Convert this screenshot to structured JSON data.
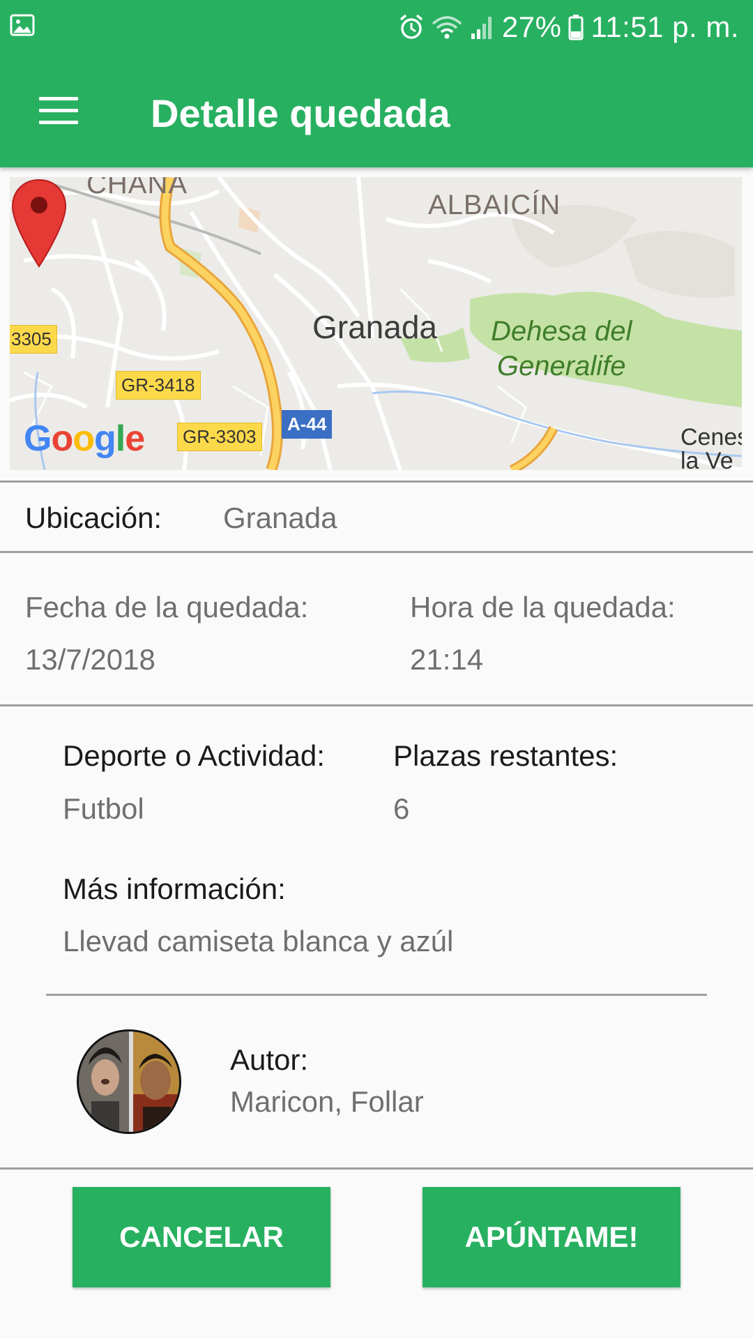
{
  "status_bar": {
    "battery": "27%",
    "time": "11:51 p. m.",
    "icons": [
      "gallery-icon",
      "alarm-icon",
      "wifi-icon",
      "signal-icon",
      "battery-icon"
    ]
  },
  "toolbar": {
    "menu_icon": "hamburger-menu-icon",
    "title": "Detalle quedada",
    "color": "#28b061"
  },
  "map": {
    "labels": {
      "chana": "CHANA",
      "albaicin": "ALBAICÍN",
      "city": "Granada",
      "park": "Dehesa del Generalife",
      "park_line1": "Dehesa del",
      "park_line2": "Generalife",
      "road_3305": "3305",
      "road_gr3418": "GR-3418",
      "road_gr3303": "GR-3303",
      "highway_a44": "A-44",
      "cenes_line1": "Cenes",
      "cenes_line2": "la Ve"
    },
    "logo": "Google"
  },
  "location": {
    "label": "Ubicación:",
    "value": "Granada"
  },
  "date": {
    "label": "Fecha de la quedada:",
    "value": "13/7/2018"
  },
  "time": {
    "label": "Hora de la quedada:",
    "value": "21:14"
  },
  "sport": {
    "label": "Deporte o Actividad:",
    "value": "Futbol"
  },
  "spots": {
    "label": "Plazas restantes:",
    "value": "6"
  },
  "info": {
    "label": "Más información:",
    "value": "Llevad camiseta blanca y azúl"
  },
  "author": {
    "label": "Autor:",
    "value": "Maricon, Follar"
  },
  "buttons": {
    "cancel": "CANCELAR",
    "join": "APÚNTAME!"
  }
}
